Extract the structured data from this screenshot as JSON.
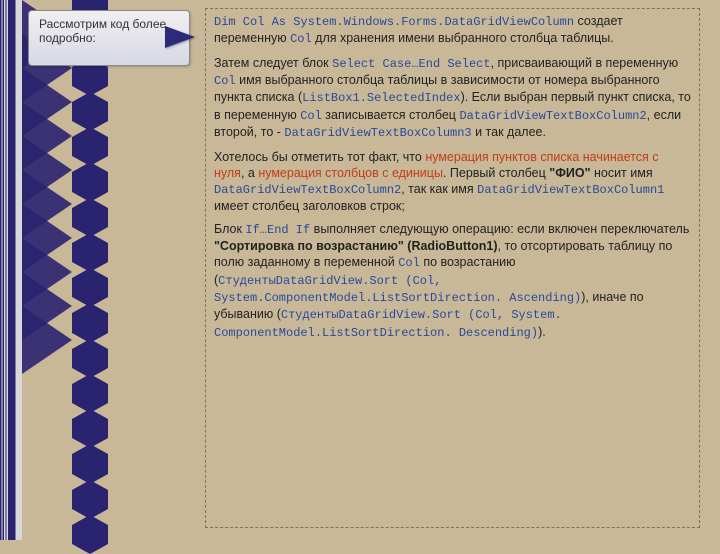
{
  "callout": "Рассмотрим код более подробно:",
  "p1": {
    "c1": "Dim Col As System.Windows.Forms.DataGridViewColumn",
    "t1": " создает переменную ",
    "c2": "Col",
    "t2": " для хранения имени выбранного столбца таблицы."
  },
  "p2": {
    "t1": "Затем следует блок ",
    "c1": "Select Case…End Select",
    "t2": ", присваивающий в переменную ",
    "c2": "Col",
    "t3": " имя выбранного столбца таблицы в зависимости от номера выбранного пункта списка (",
    "c3": "ListBox1.SelectedIndex",
    "t4": "). Если выбран первый пункт списка, то в переменную ",
    "c4": "Col",
    "t5": " записывается столбец ",
    "c5": "DataGridViewTextBoxColumn2",
    "t6": ", если второй, то - ",
    "c6": "DataGridViewTextBoxColumn3",
    "t7": " и так далее."
  },
  "p3": {
    "t1": "Хотелось бы отметить тот факт, что ",
    "r1": "нумерация пунктов списка начинается с нуля",
    "t2": ", а ",
    "r2": "нумерация столбцов с единицы",
    "t3": ". Первый столбец ",
    "b1": "\"ФИО\"",
    "t4": " носит имя ",
    "c1": "DataGridViewTextBoxColumn2",
    "t5": ", так как имя ",
    "c2": "DataGridViewTextBoxColumn1",
    "t6": " имеет столбец заголовков строк;"
  },
  "p4": {
    "t1": "Блок ",
    "c1": "If…End If",
    "t2": " выполняет следующую операцию: если включен переключатель ",
    "b1": "\"Сортировка по возрастанию\" (RadioButton1)",
    "t3": ", то отсортировать таблицу по полю заданному в переменной ",
    "c2": "Col",
    "t4": " по возрастанию (",
    "c3": "СтудентыDataGridView.Sort (Col, System.ComponentModel.ListSortDirection. Ascending)",
    "t5": "), иначе по убыванию (",
    "c4": "СтудентыDataGridView.Sort (Col, System. ComponentModel.ListSortDirection. Descending)",
    "t6": ")."
  }
}
